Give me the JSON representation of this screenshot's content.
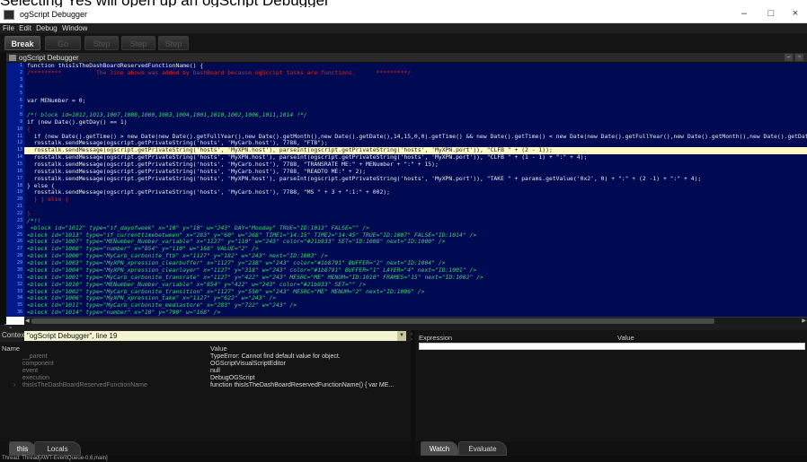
{
  "caption": {
    "text": "Selecting Yes will open up an ogScript Debugger"
  },
  "window": {
    "title": "ogScript Debugger",
    "minimize": "–",
    "maximize": "□",
    "close": "×"
  },
  "menu": [
    "File",
    "Edit",
    "Debug",
    "Window"
  ],
  "toolbar": {
    "break": "Break",
    "go": "Go",
    "step_into": "Step Into",
    "step_over": "Step Over",
    "step_out": "Step Out"
  },
  "panel": {
    "title": "ogScript Debugger",
    "min": "–",
    "restore": "▫"
  },
  "code": [
    {
      "t": "function thisIsTheDashBoardReservedFunctionName() {",
      "k": ""
    },
    {
      "t": "/*********          The line above was added by DashBoard because ogScript tasks are functions.      *********/",
      "k": "c"
    },
    {
      "t": "",
      "k": ""
    },
    {
      "t": "",
      "k": ""
    },
    {
      "t": "",
      "k": ""
    },
    {
      "t": "var MENumber = 0;",
      "k": ""
    },
    {
      "t": "",
      "k": ""
    },
    {
      "t": "/*! block id=1012,1013,1007,1008,1000,1003,1004,1001,1010,1002,1006,1011,1014 !*/",
      "k": "gc"
    },
    {
      "t": "if (new Date().getDay() == 1)",
      "k": ""
    },
    {
      "t": "{",
      "k": "c"
    },
    {
      "t": "  if (new Date().getTime() > new Date(new Date().getFullYear(),new Date().getMonth(),new Date().getDate(),14,15,0,0).getTime() && new Date().getTime() < new Date(new Date().getFullYear(),new Date().getMonth(),new Date().getDate(),",
      "k": ""
    },
    {
      "t": "  rosstalk.sendMessage(ogscript.getPrivateString('hosts', 'MyCarb.host'), 7788, \"FTB\");",
      "k": ""
    },
    {
      "t": "  rosstalk.sendMessage(ogscript.getPrivateString('hosts', 'MyXPN.host'), parseInt(ogscript.getPrivateString('hosts', 'MyXPN.port')), \"CLFB \" + (2 - 1));",
      "k": "hl"
    },
    {
      "t": "  rosstalk.sendMessage(ogscript.getPrivateString('hosts', 'MyXPN.host'), parseInt(ogscript.getPrivateString('hosts', 'MyXPN.port')), \"CLFB \" + (1 - 1) + \":\" + 4);",
      "k": ""
    },
    {
      "t": "  rosstalk.sendMessage(ogscript.getPrivateString('hosts', 'MyCarb.host'), 7788, \"TRANSRATE ME:\" + MENumber + \":\" + 15);",
      "k": ""
    },
    {
      "t": "  rosstalk.sendMessage(ogscript.getPrivateString('hosts', 'MyCarb.host'), 7788, \"READTO ME:\" + 2);",
      "k": ""
    },
    {
      "t": "  rosstalk.sendMessage(ogscript.getPrivateString('hosts', 'MyXPN.host'), parseInt(ogscript.getPrivateString('hosts', 'MyXPN.port')), \"TAKE \" + params.getValue('0x2', 0) + \":\" + (2 -1) + \":\" + 4);",
      "k": ""
    },
    {
      "t": "} else {",
      "k": ""
    },
    {
      "t": "  rosstalk.sendMessage(ogscript.getPrivateString('hosts', 'MyCarb.host'), 7788, \"MS \" + 3 + \":1:\" + 002);",
      "k": ""
    },
    {
      "t": "  } } else {",
      "k": "c"
    },
    {
      "t": "",
      "k": ""
    },
    {
      "t": "}",
      "k": "c"
    },
    {
      "t": "/*!!",
      "k": "gc"
    },
    {
      "t": " <block id=\"1012\" type=\"if_dayofweek\" x=\"10\" y=\"10\" w=\"243\" DAY=\"Monday\" TRUE=\"ID:1013\" FALSE=\"\" />",
      "k": "gc"
    },
    {
      "t": "<block id=\"1013\" type=\"if_currenttimebetween\" x=\"283\" y=\"60\" w=\"268\" TIME1=\"14:15\" TIME2=\"14:45\" TRUE=\"ID:1007\" FALSE=\"ID:1014\" />",
      "k": "gc"
    },
    {
      "t": "<block id=\"1007\" type=\"MENumber_Number_variable\" x=\"1127\" y=\"110\" w=\"243\" color=\"#21b933\" SET=\"ID:1008\" next=\"ID:1000\" />",
      "k": "gc"
    },
    {
      "t": "<block id=\"1008\" type=\"number\" x=\"854\" y=\"110\" w=\"168\" VALUE=\"2\" />",
      "k": "gc"
    },
    {
      "t": "<block id=\"1000\" type=\"MyCarb_carbonite_ftb\" x=\"1127\" y=\"182\" w=\"243\" next=\"ID:1003\" />",
      "k": "gc"
    },
    {
      "t": "<block id=\"1003\" type=\"MyXPN_xpression_clearbuffer\" x=\"1127\" y=\"238\" w=\"243\" color=\"#1b8791\" BUFFER=\"2\" next=\"ID:1004\" />",
      "k": "gc"
    },
    {
      "t": "<block id=\"1004\" type=\"MyXPN_xpression_clearlayer\" x=\"1127\" y=\"318\" w=\"243\" color=\"#1b8791\" BUFFER=\"1\" LAYER=\"4\" next=\"ID:1001\" />",
      "k": "gc"
    },
    {
      "t": "<block id=\"1001\" type=\"MyCarb_carbonite_transrate\" x=\"1127\" y=\"422\" w=\"243\" MESRC=\"ME\" MENUM=\"ID:1010\" FRAMES=\"15\" next=\"ID:1002\" />",
      "k": "gc"
    },
    {
      "t": "<block id=\"1010\" type=\"MENumber_Number_variable\" x=\"854\" y=\"422\" w=\"243\" color=\"#21b933\" SET=\"\" />",
      "k": "gc"
    },
    {
      "t": "<block id=\"1002\" type=\"MyCarb_carbonite_transition\" x=\"1127\" y=\"550\" w=\"243\" MESRC=\"ME\" MENUM=\"2\" next=\"ID:1006\" />",
      "k": "gc"
    },
    {
      "t": "<block id=\"1006\" type=\"MyXPN_xpression_take\" x=\"1127\" y=\"622\" w=\"243\" />",
      "k": "gc"
    },
    {
      "t": "<block id=\"1011\" type=\"MyCarb_carbonite_mediastore\" x=\"283\" y=\"722\" w=\"243\" />",
      "k": "gc"
    },
    {
      "t": "<block id=\"1014\" type=\"number\" x=\"10\" y=\"790\" w=\"168\" />",
      "k": "gc"
    }
  ],
  "context": {
    "label": "Context",
    "value": "\"ogScript Debugger\", line 19"
  },
  "vars": {
    "head_name": "Name",
    "head_value": "Value",
    "rows": [
      {
        "name": "__parent",
        "value": "TypeError: Cannot find default value for object."
      },
      {
        "name": "component",
        "value": "OGScriptVisualScriptEditor"
      },
      {
        "name": "event",
        "value": "null"
      },
      {
        "name": "execution",
        "value": "DebugOGScript"
      },
      {
        "name": "thisIsTheDashBoardReservedFunctionName",
        "value": "function thisIsTheDashBoardReservedFunctionName() {      var ME..."
      }
    ]
  },
  "left_tabs": [
    "this",
    "Locals"
  ],
  "expr": {
    "head_expr": "Expression",
    "head_value": "Value"
  },
  "right_tabs": [
    "Watch",
    "Evaluate"
  ],
  "status": {
    "text": "Thread: Thread[AWT-EventQueue-0,6,main]"
  }
}
